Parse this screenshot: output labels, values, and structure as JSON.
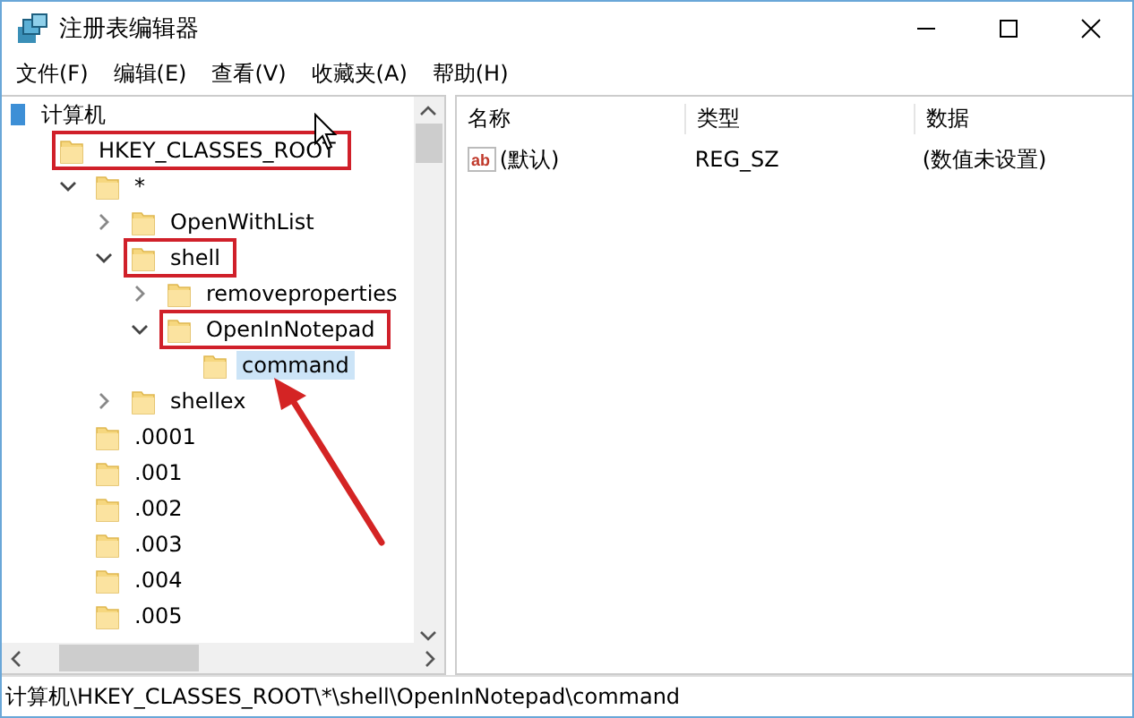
{
  "window": {
    "title": "注册表编辑器"
  },
  "menu": [
    "文件(F)",
    "编辑(E)",
    "查看(V)",
    "收藏夹(A)",
    "帮助(H)"
  ],
  "tree": {
    "label": "计算机",
    "kind": "computer",
    "selected": false,
    "boxed": false,
    "children": [
      {
        "label": "HKEY_CLASSES_ROOT",
        "kind": "folder",
        "selected": false,
        "boxed": true,
        "children": [
          {
            "label": "*",
            "kind": "folder",
            "expanded": true,
            "selected": false,
            "boxed": false,
            "children": [
              {
                "label": "OpenWithList",
                "kind": "folder",
                "expanded": false,
                "selected": false,
                "boxed": false
              },
              {
                "label": "shell",
                "kind": "folder",
                "expanded": true,
                "selected": false,
                "boxed": true,
                "children": [
                  {
                    "label": "removeproperties",
                    "kind": "folder",
                    "expanded": false,
                    "selected": false,
                    "boxed": false
                  },
                  {
                    "label": "OpenInNotepad",
                    "kind": "folder",
                    "expanded": true,
                    "selected": false,
                    "boxed": true,
                    "children": [
                      {
                        "label": "command",
                        "kind": "folder",
                        "selected": true,
                        "boxed": false
                      }
                    ]
                  }
                ]
              },
              {
                "label": "shellex",
                "kind": "folder",
                "expanded": false,
                "selected": false,
                "boxed": false
              }
            ]
          },
          {
            "label": ".0001",
            "kind": "folder",
            "selected": false,
            "boxed": false
          },
          {
            "label": ".001",
            "kind": "folder",
            "selected": false,
            "boxed": false
          },
          {
            "label": ".002",
            "kind": "folder",
            "selected": false,
            "boxed": false
          },
          {
            "label": ".003",
            "kind": "folder",
            "selected": false,
            "boxed": false
          },
          {
            "label": ".004",
            "kind": "folder",
            "selected": false,
            "boxed": false
          },
          {
            "label": ".005",
            "kind": "folder",
            "selected": false,
            "boxed": false
          }
        ]
      }
    ]
  },
  "list": {
    "columns": [
      "名称",
      "类型",
      "数据"
    ],
    "rows": [
      {
        "icon_label": "ab",
        "name": "(默认)",
        "type": "REG_SZ",
        "data": "(数值未设置)"
      }
    ]
  },
  "status_bar": "计算机\\HKEY_CLASSES_ROOT\\*\\shell\\OpenInNotepad\\command"
}
